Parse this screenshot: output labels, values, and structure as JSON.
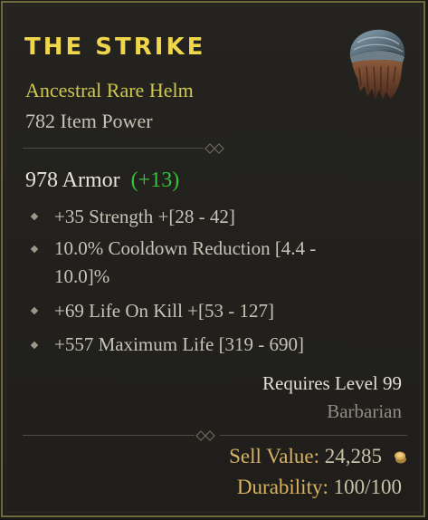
{
  "item": {
    "name": "THE STRIKE",
    "subtitle": "Ancestral Rare Helm",
    "item_power": "782 Item Power",
    "armor_value": "978 Armor",
    "armor_bonus": "(+13)",
    "affixes": [
      {
        "line1": "+35 Strength +[28 - 42]",
        "line2": ""
      },
      {
        "line1": "10.0% Cooldown Reduction [4.4 -",
        "line2": "10.0]%"
      },
      {
        "line1": "+69 Life On Kill +[53 - 127]",
        "line2": ""
      },
      {
        "line1": "+557 Maximum Life [319 - 690]",
        "line2": ""
      }
    ],
    "requirement": "Requires Level 99",
    "class": "Barbarian",
    "sell_label": "Sell Value:",
    "sell_value": "24,285",
    "durability_label": "Durability:",
    "durability_value": "100/100"
  },
  "icons": {
    "item": "helm-icon",
    "currency": "gold-coin-icon",
    "bullet": "diamond-bullet-icon"
  },
  "colors": {
    "title": "#efd64a",
    "rare": "#cfc64e",
    "bonus": "#35c13a",
    "border": "#6f6a3c",
    "label": "#d9b160"
  }
}
